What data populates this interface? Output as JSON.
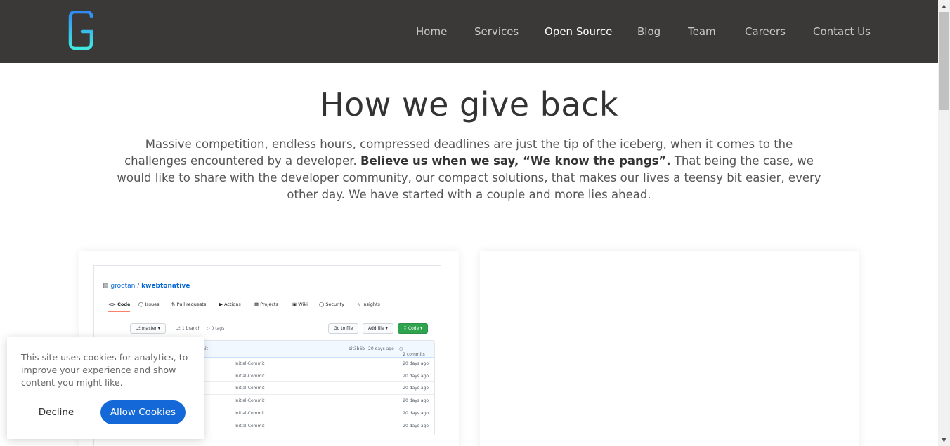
{
  "nav": {
    "items": [
      {
        "label": "Home"
      },
      {
        "label": "Services"
      },
      {
        "label": "Open Source"
      },
      {
        "label": "Blog"
      },
      {
        "label": "Team"
      },
      {
        "label": "Careers"
      },
      {
        "label": "Contact Us"
      }
    ],
    "active": "Open Source"
  },
  "logo": {
    "letter": "G",
    "gradient": [
      "#35a6ff",
      "#3ce7e2"
    ]
  },
  "hero": {
    "title": "How we give back",
    "text_before": "Massive competition, endless hours, compressed deadlines are just the tip of the iceberg, when it comes to the challenges encountered by a developer. ",
    "text_bold": "Believe us when we say, “We know the pangs”.",
    "text_after": " That being the case, we would like to share with the developer community, our compact solutions, that makes our lives a teensy bit easier, every other day. We have started with a couple and more lies ahead."
  },
  "repo": {
    "owner": "grootan",
    "separator": " / ",
    "name": "kwebtonative",
    "tabs": [
      "Code",
      "Issues",
      "Pull requests",
      "Actions",
      "Projects",
      "Wiki",
      "Security",
      "Insights"
    ],
    "branch": "master",
    "branch_count": "1 branch",
    "tags": "0 tags",
    "go_to_file": "Go to file",
    "add_file": "Add file",
    "code_button": "Code",
    "head_commit": "nit",
    "head_author": "bit3b6b",
    "head_age": "20 days ago",
    "commits": "2 commits",
    "rows": [
      {
        "message": "Initial-Commit",
        "age": "20 days ago"
      },
      {
        "message": "Initial-Commit",
        "age": "20 days ago"
      },
      {
        "message": "Initial-Commit",
        "age": "20 days ago"
      },
      {
        "message": "Initial-Commit",
        "age": "20 days ago"
      },
      {
        "message": "Initial-Commit",
        "age": "20 days ago"
      },
      {
        "message": "Initial-Commit",
        "age": "20 days ago"
      }
    ]
  },
  "cookie": {
    "text": "This site uses cookies for analytics, to improve your experience and show content you might like.",
    "decline": "Decline",
    "allow": "Allow Cookies"
  },
  "colors": {
    "header_bg": "#3a3937",
    "accent": "#1468d8",
    "nav_active": "#ffffff",
    "nav_inactive": "#c9c9c9"
  }
}
